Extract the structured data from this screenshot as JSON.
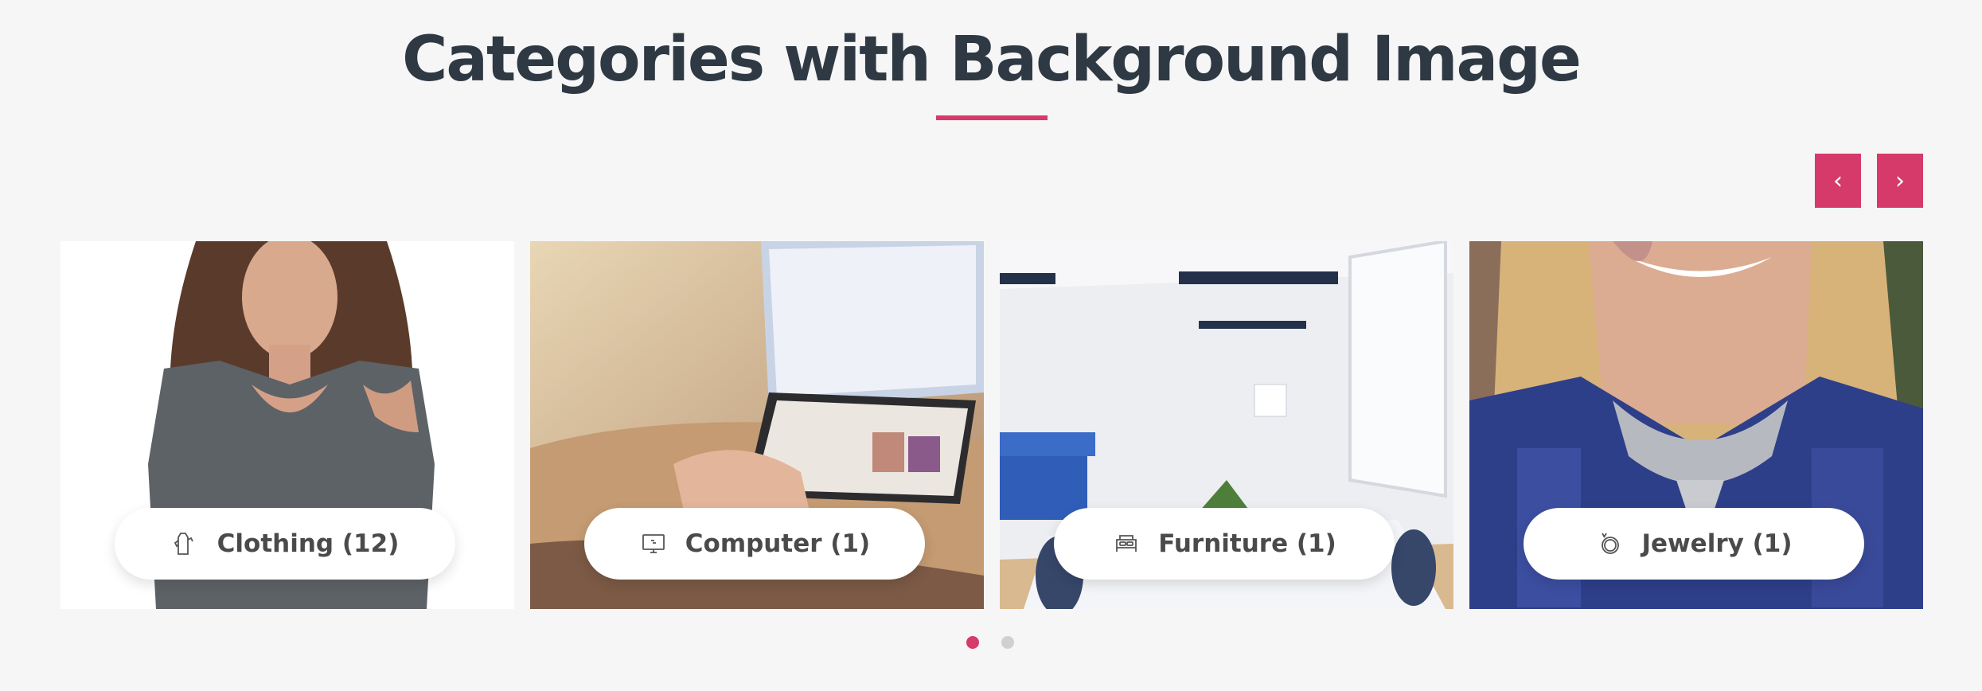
{
  "section": {
    "title": "Categories with Background Image"
  },
  "carousel": {
    "prev_icon": "chevron-left-icon",
    "next_icon": "chevron-right-icon",
    "prev_glyph": "‹",
    "next_glyph": "›",
    "active_page": 1,
    "page_count": 2
  },
  "categories": [
    {
      "label": "Clothing (12)",
      "icon": "shirt-icon",
      "image": "woman in grey cold-shoulder top"
    },
    {
      "label": "Computer (1)",
      "icon": "monitor-icon",
      "image": "hands using a tablet in front of a laptop"
    },
    {
      "label": "Furniture (1)",
      "icon": "bed-icon",
      "image": "white meeting room with blue sofa"
    },
    {
      "label": "Jewelry (1)",
      "icon": "ring-icon",
      "image": "smiling woman wearing a silver necklace"
    }
  ],
  "colors": {
    "accent": "#d63a6a",
    "title": "#2f3944",
    "background": "#f6f6f6",
    "dot_inactive": "#d0d0d0"
  }
}
